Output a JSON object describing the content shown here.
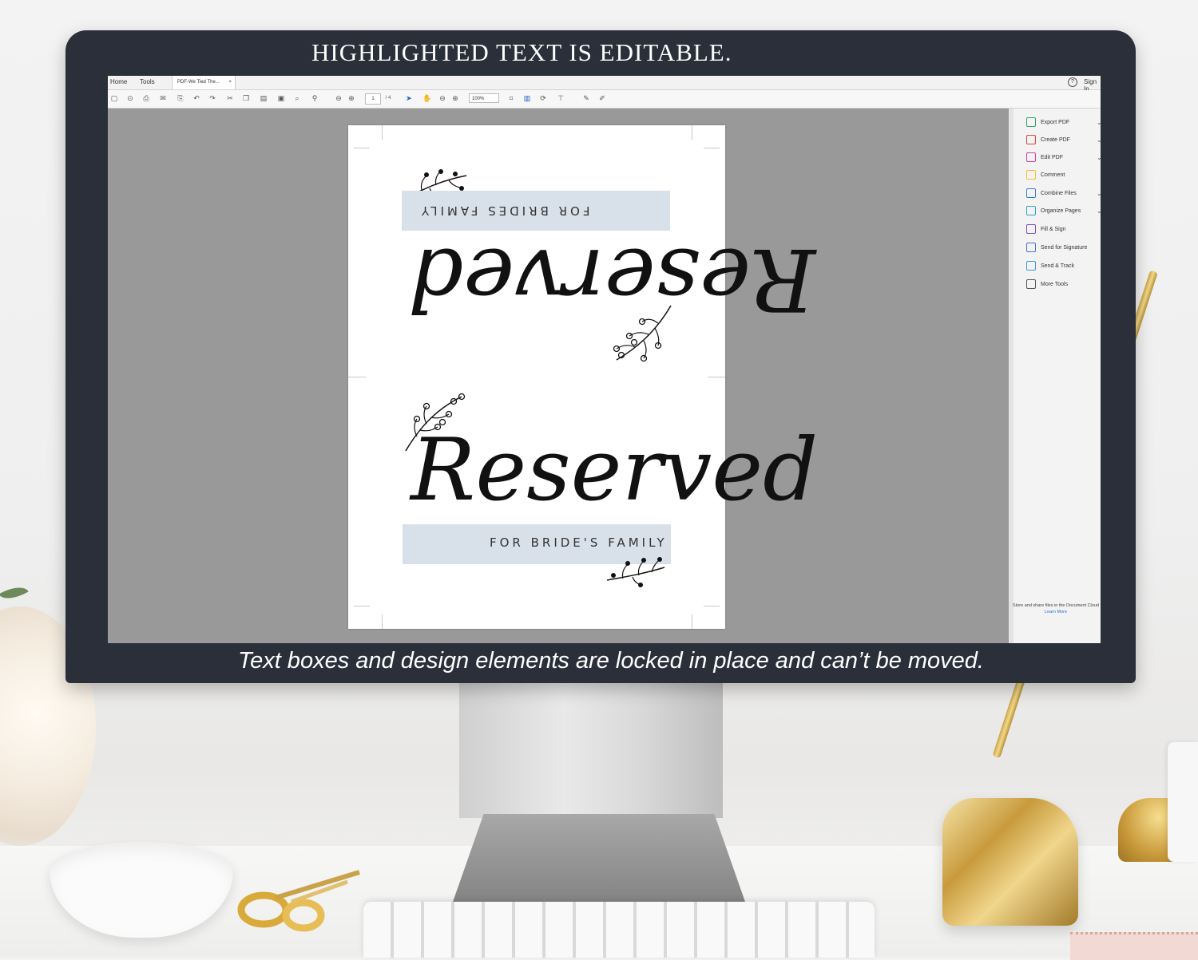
{
  "headline": "HIGHLIGHTED TEXT IS EDITABLE.",
  "caption": "Text boxes and design elements are locked in place and can’t be moved.",
  "app": {
    "menu": [
      "Home",
      "Tools"
    ],
    "document_tab": "PDF-We Tied The...",
    "sign_in": "Sign In",
    "page_number": "1",
    "page_total": "/ 4",
    "zoom": "100%",
    "tools": [
      {
        "label": "Export PDF",
        "icon": "export-pdf-icon",
        "color": "#2fa36b"
      },
      {
        "label": "Create PDF",
        "icon": "create-pdf-icon",
        "color": "#e0443a"
      },
      {
        "label": "Edit PDF",
        "icon": "edit-pdf-icon",
        "color": "#d6449a"
      },
      {
        "label": "Comment",
        "icon": "comment-icon",
        "color": "#f2c12e"
      },
      {
        "label": "Combine Files",
        "icon": "combine-files-icon",
        "color": "#3a7bd5"
      },
      {
        "label": "Organize Pages",
        "icon": "organize-pages-icon",
        "color": "#2aa6c9"
      },
      {
        "label": "Fill & Sign",
        "icon": "fill-sign-icon",
        "color": "#7a4fc9"
      },
      {
        "label": "Send for Signature",
        "icon": "send-signature-icon",
        "color": "#4a6fd8"
      },
      {
        "label": "Send & Track",
        "icon": "send-track-icon",
        "color": "#3c9ad6"
      },
      {
        "label": "More Tools",
        "icon": "more-tools-icon",
        "color": "#555555"
      }
    ],
    "promo_text": "Store and share files in the Document Cloud",
    "promo_link": "Learn More"
  },
  "document": {
    "top_title": "Reserved",
    "top_subtitle": "FOR BRIDES FAMILY",
    "bottom_title": "Reserved",
    "bottom_subtitle": "FOR BRIDE'S FAMILY",
    "band_color": "#d8e1ea"
  }
}
